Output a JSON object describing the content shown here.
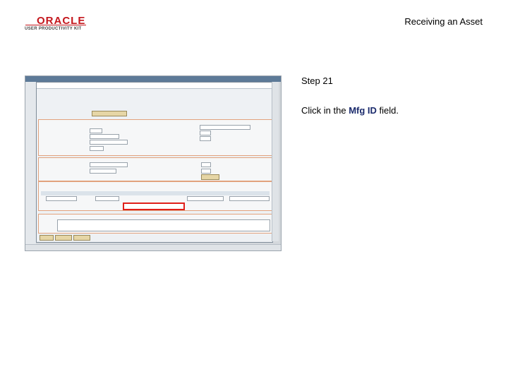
{
  "header": {
    "logo_brand": "ORACLE",
    "logo_sub": "USER PRODUCTIVITY KIT",
    "doc_title": "Receiving an Asset"
  },
  "step": {
    "number_label": "Step 21",
    "instruction_prefix": "Click in the ",
    "instruction_field": "Mfg ID",
    "instruction_suffix": " field."
  },
  "colors": {
    "brand_red": "#c4161c",
    "highlight_red": "#e0201a",
    "instruction_bold": "#1a2a6c"
  }
}
